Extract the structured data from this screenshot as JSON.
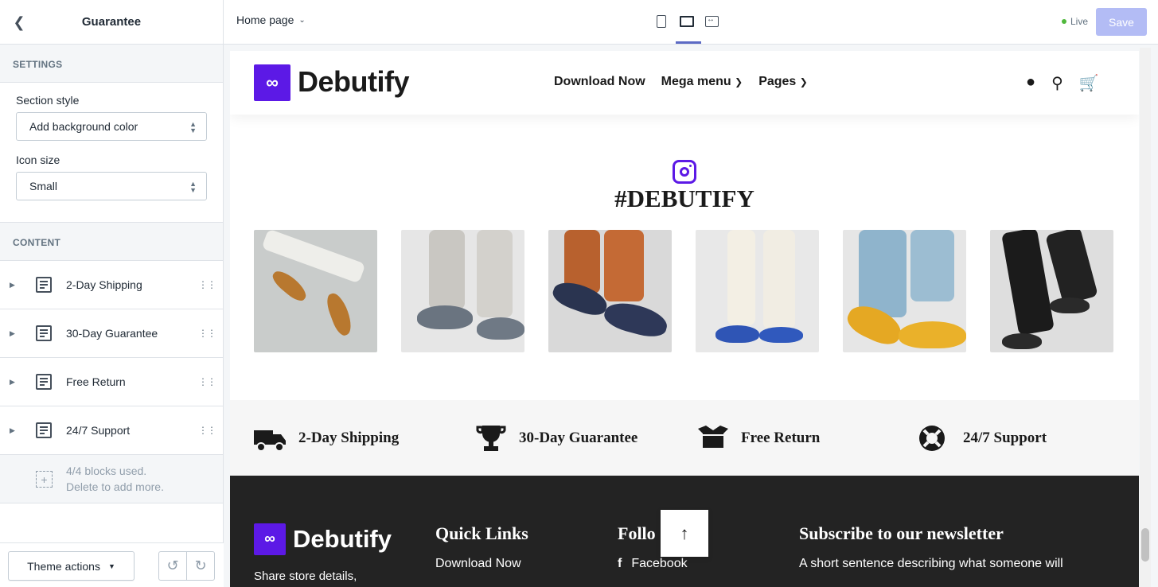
{
  "sidebar": {
    "title": "Guarantee",
    "settings_label": "SETTINGS",
    "section_style_label": "Section style",
    "section_style_value": "Add background color",
    "icon_size_label": "Icon size",
    "icon_size_value": "Small",
    "content_label": "CONTENT",
    "blocks": [
      {
        "label": "2-Day Shipping"
      },
      {
        "label": "30-Day Guarantee"
      },
      {
        "label": "Free Return"
      },
      {
        "label": "24/7 Support"
      }
    ],
    "blocks_used_line1": "4/4 blocks used.",
    "blocks_used_line2": "Delete to add more.",
    "theme_actions": "Theme actions"
  },
  "topbar": {
    "page": "Home page",
    "live": "Live",
    "save": "Save"
  },
  "store": {
    "logo_mark": "∞",
    "brand": "Debutify",
    "nav": [
      "Download Now",
      "Mega menu",
      "Pages"
    ],
    "hashtag": "#DEBUTIFY",
    "guarantees": [
      "2-Day Shipping",
      "30-Day Guarantee",
      "Free Return",
      "24/7 Support"
    ],
    "footer": {
      "store_details": "Share store details,",
      "quick_links": "Quick Links",
      "quick_link_1": "Download Now",
      "follow": "Follo",
      "facebook": "Facebook",
      "subscribe": "Subscribe to our newsletter",
      "subscribe_text": "A short sentence describing what someone will"
    }
  },
  "colors": {
    "accent": "#5c19e6",
    "save_disabled": "#b3bcf5",
    "live_dot": "#50b83c",
    "footer_bg": "#232323"
  }
}
